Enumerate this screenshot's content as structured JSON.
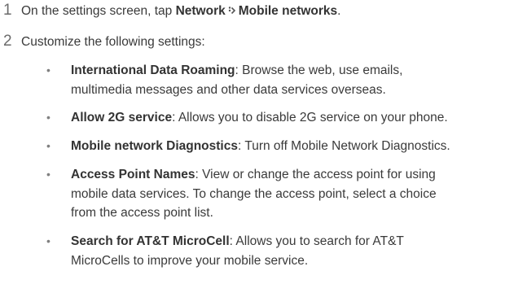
{
  "steps": [
    {
      "number": "1",
      "prefix": "On the settings screen, tap ",
      "menu_first": "Network",
      "menu_second": "Mobile networks",
      "suffix": "."
    },
    {
      "number": "2",
      "text": "Customize the following settings:"
    }
  ],
  "settings": [
    {
      "name": "International Data Roaming",
      "lines": [
        ": Browse the web, use emails,",
        "multimedia messages and other data services overseas."
      ]
    },
    {
      "name": "Allow 2G service",
      "lines": [
        ": Allows you to disable 2G service on your phone."
      ]
    },
    {
      "name": "Mobile network Diagnostics",
      "lines": [
        ": Turn off Mobile Network Diagnostics."
      ]
    },
    {
      "name": "Access Point Names",
      "lines": [
        ": View or change the access point for using",
        "mobile data services. To change the access point, select a choice",
        "from the access point list."
      ]
    },
    {
      "name": "Search for AT&T MicroCell",
      "lines": [
        ": Allows you to search for AT&T",
        "MicroCells to improve your mobile service."
      ]
    }
  ],
  "bullet_glyph": "•",
  "icons": {
    "menu_separator": "chevron-right-icon"
  }
}
